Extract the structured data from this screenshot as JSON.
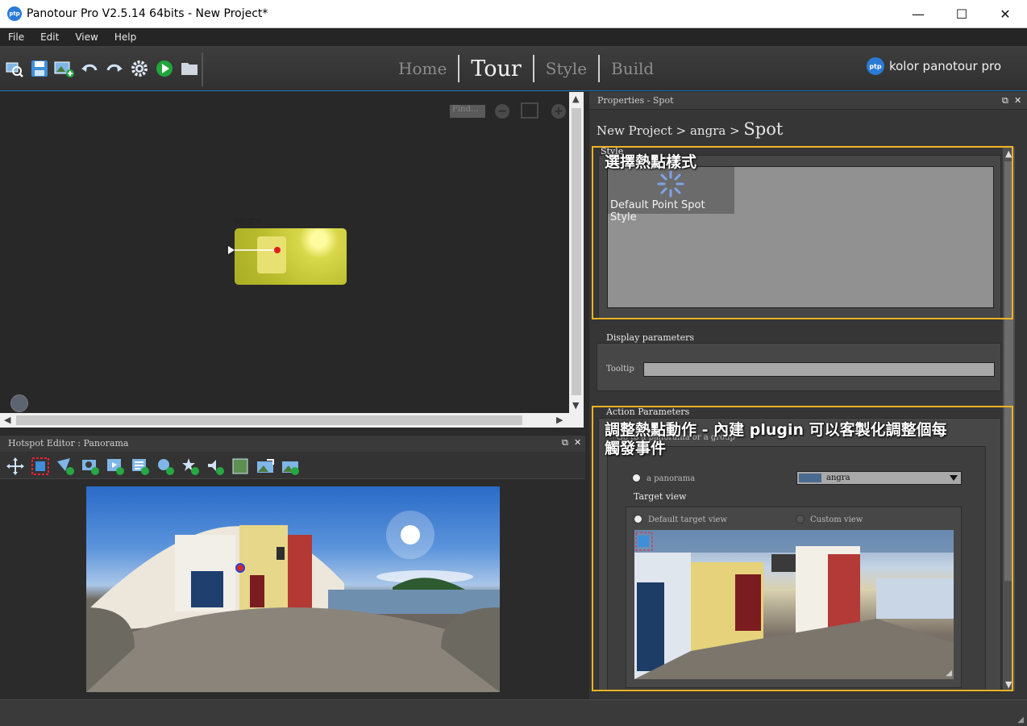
{
  "window": {
    "title": "Panotour Pro V2.5.14 64bits - New Project*",
    "app_icon_text": "ptp",
    "minimize": "—",
    "maximize": "☐",
    "close": "✕"
  },
  "menu": [
    "File",
    "Edit",
    "View",
    "Help"
  ],
  "toolbar": {
    "icons": [
      "search-panorama-icon",
      "save-icon",
      "add-panorama-icon",
      "undo-icon",
      "redo-icon",
      "settings-icon",
      "play-icon",
      "folder-icon"
    ],
    "tabs": [
      "Home",
      "Tour",
      "Style",
      "Build"
    ],
    "active_tab": "Tour",
    "brand_logo": "ptp",
    "brand": "kolor panotour pro"
  },
  "graph": {
    "find_placeholder": "Find...",
    "node_label": "angra"
  },
  "hotspot_editor": {
    "title": "Hotspot Editor : Panorama",
    "icons": [
      "move-select-icon",
      "select-rectangle-icon",
      "add-point-spot-icon",
      "add-photo-spot-icon",
      "add-video-spot-icon",
      "add-text-spot-icon",
      "add-zoom-spot-icon",
      "add-star-spot-icon",
      "add-sound-spot-icon",
      "add-polygon-spot-icon",
      "add-panorama-link-icon",
      "export-icon"
    ]
  },
  "properties": {
    "title": "Properties - Spot",
    "breadcrumb": [
      "New Project",
      "angra"
    ],
    "breadcrumb_sep": " > ",
    "breadcrumb_current": "Spot",
    "style_group": "Style",
    "style_card_label": "Default Point Spot Style",
    "display_group": "Display parameters",
    "tooltip_label": "Tooltip",
    "tooltip_value": "",
    "action_group": "Action Parameters",
    "goto_group": "Go to a panorama or a group",
    "radio_panorama": "a panorama",
    "selected_panorama": "angra",
    "target_view_label": "Target view",
    "radio_default_view": "Default target view",
    "radio_custom_view": "Custom view"
  },
  "annotations": {
    "style_note": "選擇熱點樣式",
    "action_note_line1": "調整熱點動作 - 內建 plugin 可以客製化調整個每",
    "action_note_line2": "觸發事件",
    "color": "#f2b324"
  }
}
